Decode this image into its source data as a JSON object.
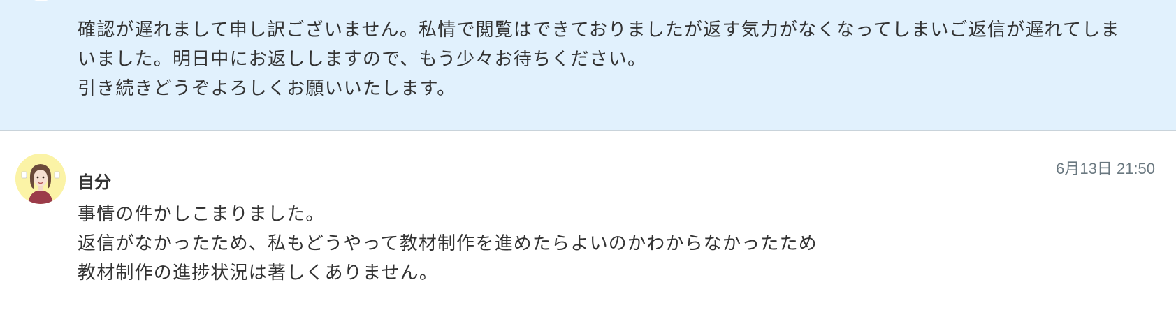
{
  "received": {
    "lines": [
      "確認が遅れまして申し訳ございません。私情で閲覧はできておりましたが返す気力がなくなってしまいご返信が遅れてしま",
      "いました。明日中にお返ししますので、もう少々お待ちください。",
      "引き続きどうぞよろしくお願いいたします。"
    ]
  },
  "sent": {
    "sender": "自分",
    "timestamp": "6月13日 21:50",
    "lines": [
      "事情の件かしこまりました。",
      "返信がなかったため、私もどうやって教材制作を進めたらよいのかわからなかったため",
      "教材制作の進捗状況は著しくありません。"
    ]
  },
  "colors": {
    "received_bg": "#e1f1fd",
    "avatar_bg": "#fbf3a6",
    "text": "#333333",
    "timestamp": "#6a7880"
  }
}
